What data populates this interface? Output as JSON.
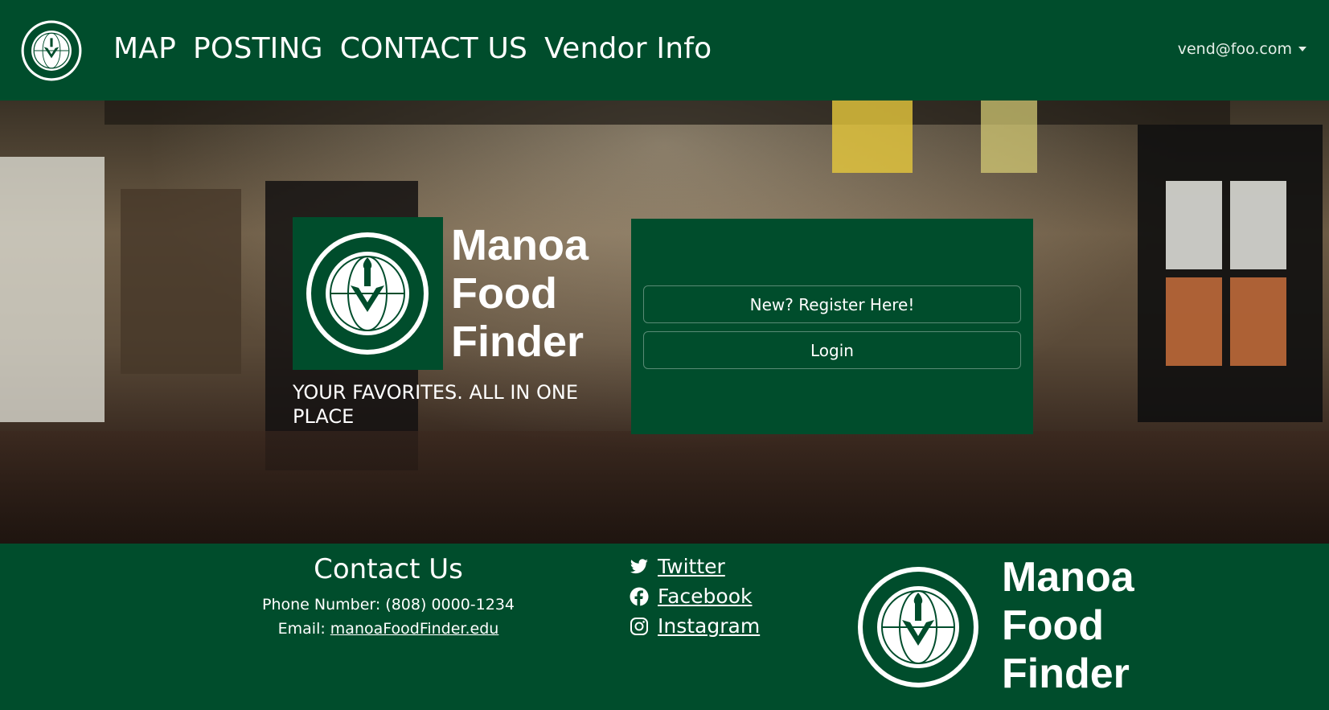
{
  "nav": {
    "logo_icon": "uh-seal-logo",
    "links": [
      "MAP",
      "POSTING",
      "CONTACT US",
      "Vendor Info"
    ],
    "user_email": "vend@foo.com"
  },
  "hero": {
    "title_lines": [
      "Manoa",
      "Food",
      "Finder"
    ],
    "tagline": "YOUR FAVORITES. ALL IN ONE PLACE",
    "register_label": "New? Register Here!",
    "login_label": "Login"
  },
  "footer": {
    "contact_title": "Contact Us",
    "phone_label": "Phone Number: (808) 0000-1234",
    "email_prefix": "Email: ",
    "email_link": "manoaFoodFinder.edu",
    "socials": [
      {
        "icon": "twitter-icon",
        "label": "Twitter"
      },
      {
        "icon": "facebook-icon",
        "label": "Facebook"
      },
      {
        "icon": "instagram-icon",
        "label": "Instagram"
      }
    ],
    "title_lines": [
      "Manoa",
      "Food",
      "Finder"
    ]
  },
  "colors": {
    "brand_green": "#004d2c"
  }
}
